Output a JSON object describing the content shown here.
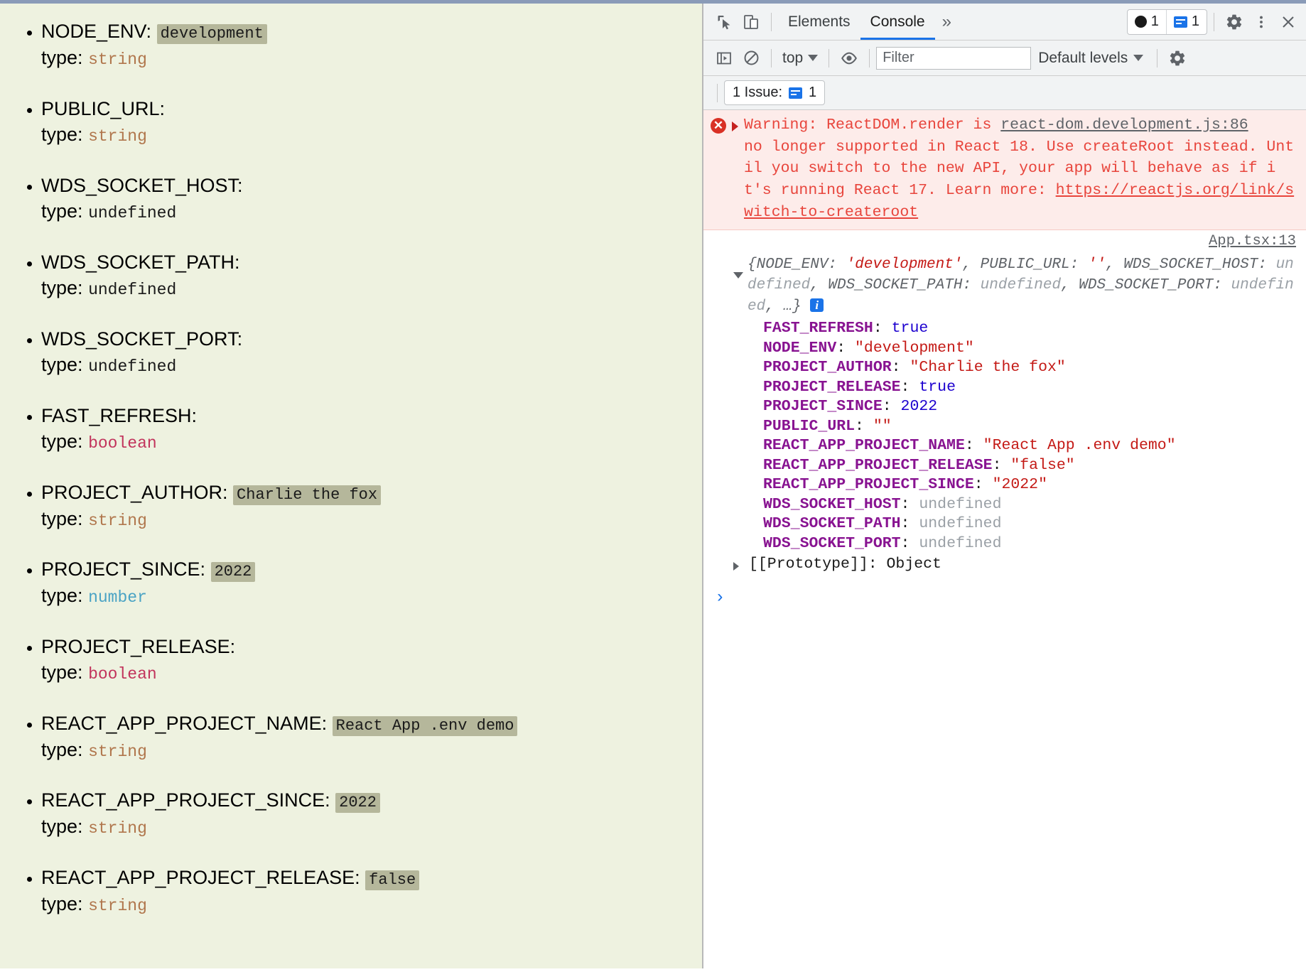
{
  "page": {
    "env_vars": [
      {
        "name": "NODE_ENV:",
        "value": "development",
        "type_label": "type:",
        "type": "string"
      },
      {
        "name": "PUBLIC_URL:",
        "value": "",
        "type_label": "type:",
        "type": "string"
      },
      {
        "name": "WDS_SOCKET_HOST:",
        "value": "",
        "type_label": "type:",
        "type": "undefined"
      },
      {
        "name": "WDS_SOCKET_PATH:",
        "value": "",
        "type_label": "type:",
        "type": "undefined"
      },
      {
        "name": "WDS_SOCKET_PORT:",
        "value": "",
        "type_label": "type:",
        "type": "undefined"
      },
      {
        "name": "FAST_REFRESH:",
        "value": "",
        "type_label": "type:",
        "type": "boolean"
      },
      {
        "name": "PROJECT_AUTHOR:",
        "value": "Charlie the fox",
        "type_label": "type:",
        "type": "string"
      },
      {
        "name": "PROJECT_SINCE:",
        "value": "2022",
        "type_label": "type:",
        "type": "number"
      },
      {
        "name": "PROJECT_RELEASE:",
        "value": "",
        "type_label": "type:",
        "type": "boolean"
      },
      {
        "name": "REACT_APP_PROJECT_NAME:",
        "value": "React App .env demo",
        "type_label": "type:",
        "type": "string"
      },
      {
        "name": "REACT_APP_PROJECT_SINCE:",
        "value": "2022",
        "type_label": "type:",
        "type": "string"
      },
      {
        "name": "REACT_APP_PROJECT_RELEASE:",
        "value": "false",
        "type_label": "type:",
        "type": "string"
      }
    ]
  },
  "devtools": {
    "toolbar": {
      "inspect_icon": "inspect-element-icon",
      "device_icon": "device-toolbar-icon",
      "tabs": [
        {
          "label": "Elements",
          "active": false
        },
        {
          "label": "Console",
          "active": true
        }
      ],
      "more_tabs_glyph": "»",
      "error_count": "1",
      "warning_count": "1",
      "settings_icon": "gear-icon",
      "more_icon": "kebab-menu-icon",
      "close_icon": "close-icon"
    },
    "console_bar": {
      "sidebar_toggle_icon": "console-sidebar-icon",
      "clear_icon": "clear-console-icon",
      "context": "top",
      "eye_icon": "live-expression-icon",
      "filter_placeholder": "Filter",
      "filter_value": "",
      "levels": "Default levels",
      "settings_icon": "gear-icon"
    },
    "issues_bar": {
      "label": "1 Issue:",
      "count": "1"
    },
    "messages": {
      "error": {
        "icon": "error-circle-icon",
        "source": "react-dom.development.js:86",
        "text_line1": "Warning: ReactDOM.render is",
        "text_rest": "no longer supported in React 18. Use createRoot instead. Until you switch to the new API, your app will behave as if it's running React 17. Learn more: ",
        "link": "https://reactjs.org/link/switch-to-createroot"
      },
      "log": {
        "source": "App.tsx:13",
        "preview_prefix": "{NODE_ENV: ",
        "preview_str1": "'development'",
        "preview_mid": ", PUBLIC_URL: ",
        "preview_str2": "''",
        "preview_mid2": ", WDS_SOCKET_HOST: ",
        "preview_und1": "undefined",
        "preview_mid3": ", WDS_SOCKET_PATH: ",
        "preview_und2": "undefined",
        "preview_mid4": ", WDS_SOCKET_PORT: ",
        "preview_und3": "undefined",
        "preview_suffix": ", …}",
        "info_badge": "i",
        "properties": [
          {
            "key": "FAST_REFRESH",
            "value": "true",
            "kind": "bool"
          },
          {
            "key": "NODE_ENV",
            "value": "\"development\"",
            "kind": "str"
          },
          {
            "key": "PROJECT_AUTHOR",
            "value": "\"Charlie the fox\"",
            "kind": "str"
          },
          {
            "key": "PROJECT_RELEASE",
            "value": "true",
            "kind": "bool"
          },
          {
            "key": "PROJECT_SINCE",
            "value": "2022",
            "kind": "num"
          },
          {
            "key": "PUBLIC_URL",
            "value": "\"\"",
            "kind": "str"
          },
          {
            "key": "REACT_APP_PROJECT_NAME",
            "value": "\"React App .env demo\"",
            "kind": "str"
          },
          {
            "key": "REACT_APP_PROJECT_RELEASE",
            "value": "\"false\"",
            "kind": "str"
          },
          {
            "key": "REACT_APP_PROJECT_SINCE",
            "value": "\"2022\"",
            "kind": "str"
          },
          {
            "key": "WDS_SOCKET_HOST",
            "value": "undefined",
            "kind": "und"
          },
          {
            "key": "WDS_SOCKET_PATH",
            "value": "undefined",
            "kind": "und"
          },
          {
            "key": "WDS_SOCKET_PORT",
            "value": "undefined",
            "kind": "und"
          }
        ],
        "prototype_label": "[[Prototype]]: Object"
      }
    },
    "prompt_glyph": "›"
  },
  "colors": {
    "page_bg": "#eef2e0",
    "accent_blue": "#1a73e8",
    "error_red": "#e8453c",
    "key_purple": "#881391",
    "string_red": "#c41a16",
    "number_blue": "#1c00cf",
    "undefined_gray": "#9aa0a6",
    "value_chip_bg": "#b5b79b"
  }
}
